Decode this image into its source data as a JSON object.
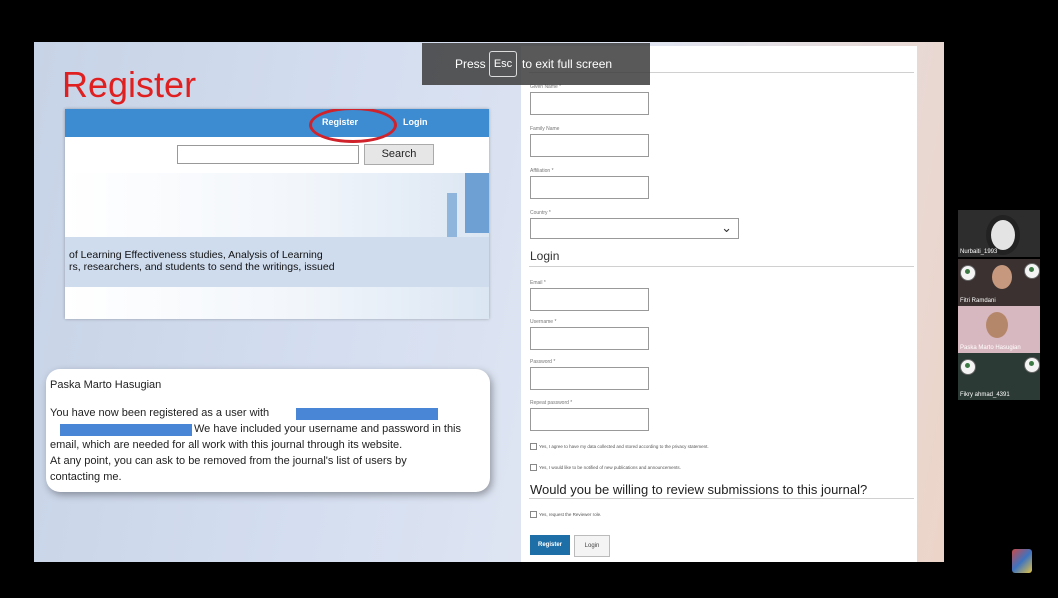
{
  "slide": {
    "title": "Register",
    "inset": {
      "nav_register": "Register",
      "nav_login": "Login",
      "search_button": "Search",
      "line1": "of Learning Effectiveness studies, Analysis of Learning",
      "line2": "rs, researchers, and students to send the writings, issued"
    },
    "email": {
      "name": "Paska Marto Hasugian",
      "line1": "You have now been registered as a user with",
      "line2": "We have included your username and password in this",
      "line3": "email, which are needed for all work with this journal through its website.",
      "line4": "At any point, you can ask to be removed from the journal's list of users by",
      "line5": "contacting me."
    }
  },
  "form": {
    "given_name_label": "Given Name *",
    "family_name_label": "Family Name",
    "affiliation_label": "Affiliation *",
    "country_label": "Country *",
    "login_heading": "Login",
    "email_label": "Email *",
    "username_label": "Username *",
    "password_label": "Password *",
    "repeat_password_label": "Repeat password *",
    "consent_label": "Yes, I agree to have my data collected and stored according to the privacy statement.",
    "notify_label": "Yes, I would like to be notified of new publications and announcements.",
    "reviewer_heading": "Would you be willing to review submissions to this journal?",
    "reviewer_label": "Yes, request the Reviewer role.",
    "register_button": "Register",
    "login_button": "Login"
  },
  "fullscreen_notice": {
    "press": "Press",
    "key": "Esc",
    "rest": "to exit full screen"
  },
  "participants": [
    {
      "name": "Nurbaiti_1993"
    },
    {
      "name": "Fitri Ramdani"
    },
    {
      "name": "Paska Marto Hasugian"
    },
    {
      "name": "Fikry ahmad_4391"
    }
  ]
}
